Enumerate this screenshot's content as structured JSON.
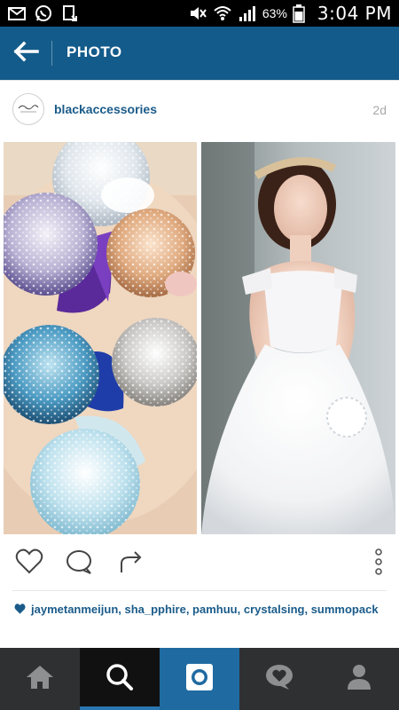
{
  "status_bar": {
    "time": "3:04 PM",
    "battery_percent": "63%",
    "icons": [
      "email-icon",
      "whatsapp-icon",
      "download-icon",
      "mute-icon",
      "wifi-icon",
      "signal-icon",
      "battery-icon"
    ]
  },
  "app_bar": {
    "title": "PHOTO",
    "back_icon": "arrow-left-icon"
  },
  "post": {
    "username": "blackaccessories",
    "time_ago": "2d",
    "avatar_text": "Black Accessories",
    "likes_text": "jaymetanmeijun, sha_pphire, pamhuu, crystalsing, summopack"
  },
  "actions": {
    "icons": [
      "heart-icon",
      "comment-icon",
      "share-icon",
      "more-vertical-icon"
    ]
  },
  "bottom_nav": {
    "items": [
      "home-icon",
      "search-icon",
      "camera-icon",
      "activity-icon",
      "profile-icon"
    ],
    "active": "search"
  },
  "colors": {
    "app_bar": "#135b8a",
    "username": "#1a5b8a",
    "nav_bg": "#2f3032",
    "nav_active_camera": "#1f6aa1"
  }
}
